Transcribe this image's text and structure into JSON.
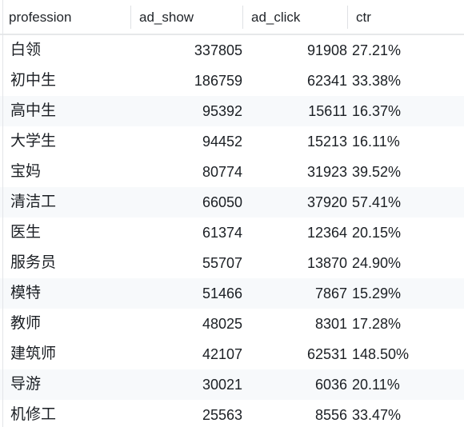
{
  "table": {
    "columns": [
      {
        "key": "profession",
        "label": "profession",
        "align": "left"
      },
      {
        "key": "ad_show",
        "label": "ad_show",
        "align": "right"
      },
      {
        "key": "ad_click",
        "label": "ad_click",
        "align": "right"
      },
      {
        "key": "ctr",
        "label": "ctr",
        "align": "left"
      }
    ],
    "rows": [
      {
        "profession": "白领",
        "ad_show": "337805",
        "ad_click": "91908",
        "ctr": "27.21%"
      },
      {
        "profession": "初中生",
        "ad_show": "186759",
        "ad_click": "62341",
        "ctr": "33.38%"
      },
      {
        "profession": "高中生",
        "ad_show": "95392",
        "ad_click": "15611",
        "ctr": "16.37%"
      },
      {
        "profession": "大学生",
        "ad_show": "94452",
        "ad_click": "15213",
        "ctr": "16.11%"
      },
      {
        "profession": "宝妈",
        "ad_show": "80774",
        "ad_click": "31923",
        "ctr": "39.52%"
      },
      {
        "profession": "清洁工",
        "ad_show": "66050",
        "ad_click": "37920",
        "ctr": "57.41%"
      },
      {
        "profession": "医生",
        "ad_show": "61374",
        "ad_click": "12364",
        "ctr": "20.15%"
      },
      {
        "profession": "服务员",
        "ad_show": "55707",
        "ad_click": "13870",
        "ctr": "24.90%"
      },
      {
        "profession": "模特",
        "ad_show": "51466",
        "ad_click": "7867",
        "ctr": "15.29%"
      },
      {
        "profession": "教师",
        "ad_show": "48025",
        "ad_click": "8301",
        "ctr": "17.28%"
      },
      {
        "profession": "建筑师",
        "ad_show": "42107",
        "ad_click": "62531",
        "ctr": "148.50%"
      },
      {
        "profession": "导游",
        "ad_show": "30021",
        "ad_click": "6036",
        "ctr": "20.11%"
      },
      {
        "profession": "机修工",
        "ad_show": "25563",
        "ad_click": "8556",
        "ctr": "33.47%"
      }
    ],
    "striped_row_indices": [
      2,
      5,
      8,
      11
    ],
    "colors": {
      "row_background": "#ffffff",
      "row_background_striped": "#f7f9fb",
      "header_text": "#1f2328",
      "body_text": "#1b1f24",
      "border": "#e6e8ea",
      "divider": "#dfe1e4"
    }
  }
}
